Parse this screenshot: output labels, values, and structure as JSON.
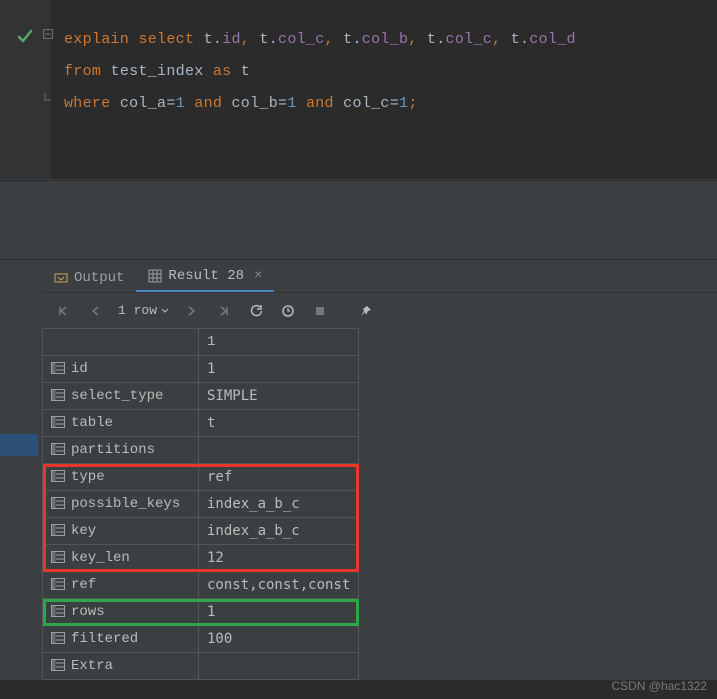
{
  "editor": {
    "line1": {
      "kw1": "explain",
      "kw2": "select",
      "t1": "t",
      "dot": ".",
      "id": "id",
      "comma": ", ",
      "colc": "col_c",
      "colb": "col_b",
      "cold": "col_d"
    },
    "line2": {
      "kw_from": "from",
      "tbl": "test_index",
      "kw_as": "as",
      "alias": "t"
    },
    "line3": {
      "kw_where": "where",
      "cola": "col_a",
      "eq": "=",
      "one": "1",
      "kw_and": "and",
      "colb": "col_b",
      "colc": "col_c",
      "semi": ";"
    }
  },
  "tabs": {
    "output": "Output",
    "result": "Result 28"
  },
  "toolbar": {
    "rowcount": "1 row"
  },
  "grid": {
    "header_val": "1",
    "rows": [
      {
        "k": "id",
        "v": "1"
      },
      {
        "k": "select_type",
        "v": "SIMPLE"
      },
      {
        "k": "table",
        "v": "t"
      },
      {
        "k": "partitions",
        "v": "<null>",
        "null": true
      },
      {
        "k": "type",
        "v": "ref"
      },
      {
        "k": "possible_keys",
        "v": "index_a_b_c"
      },
      {
        "k": "key",
        "v": "index_a_b_c"
      },
      {
        "k": "key_len",
        "v": "12"
      },
      {
        "k": "ref",
        "v": "const,const,const"
      },
      {
        "k": "rows",
        "v": "1"
      },
      {
        "k": "filtered",
        "v": "100"
      },
      {
        "k": "Extra",
        "v": "<null>",
        "null": true
      }
    ]
  },
  "watermark": "CSDN @hac1322"
}
